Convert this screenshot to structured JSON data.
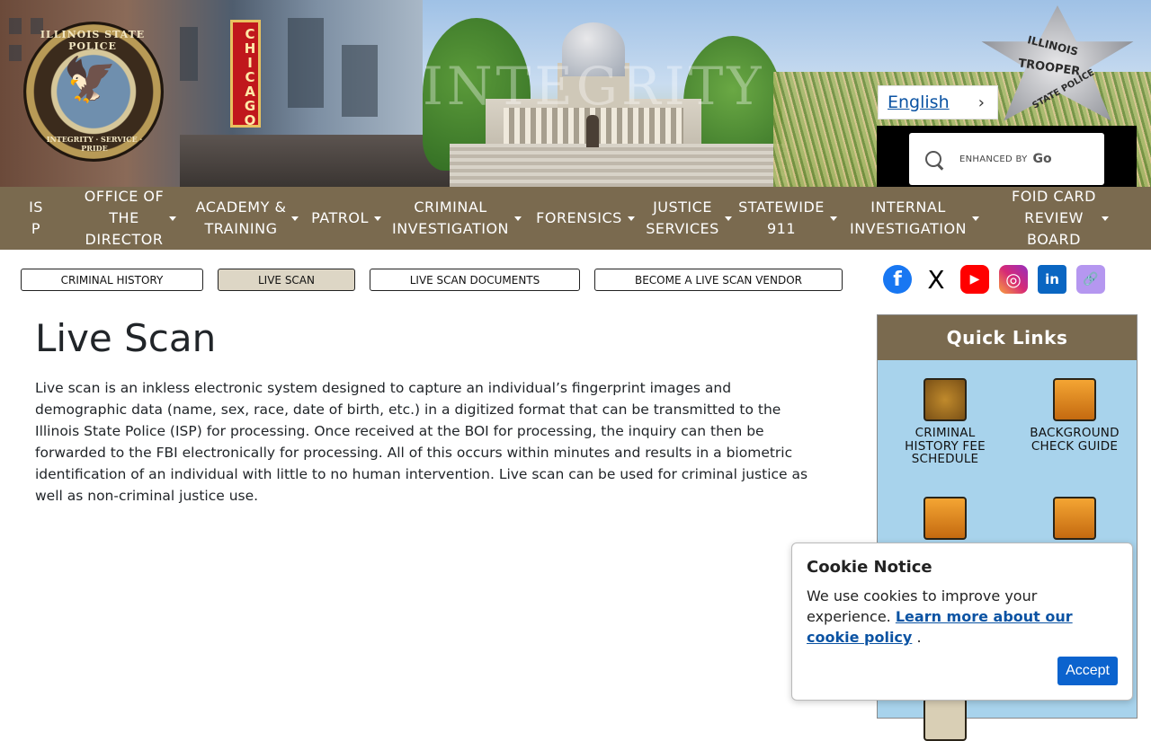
{
  "header": {
    "watermark": "INTEGRITY",
    "chicago_sign": "CHICAGO",
    "seal": {
      "top_text": "ILLINOIS STATE POLICE",
      "bottom_text": "INTEGRITY · SERVICE · PRIDE"
    },
    "badge": {
      "line1": "ILLINOIS",
      "line2": "TROOPER",
      "line3": "STATE POLICE"
    },
    "language": {
      "label": "English",
      "chevron": "›"
    },
    "search": {
      "enhanced_by": "ENHANCED BY",
      "go": "Go"
    }
  },
  "nav": {
    "items": [
      {
        "label": "IS\nP",
        "has_menu": false
      },
      {
        "label": "OFFICE OF\nTHE\nDIRECTOR",
        "has_menu": true
      },
      {
        "label": "ACADEMY &\nTRAINING",
        "has_menu": true
      },
      {
        "label": "PATROL",
        "has_menu": true
      },
      {
        "label": "CRIMINAL\nINVESTIGATION",
        "has_menu": true
      },
      {
        "label": "FORENSICS",
        "has_menu": true
      },
      {
        "label": "JUSTICE\nSERVICES",
        "has_menu": true
      },
      {
        "label": "STATEWIDE\n911",
        "has_menu": true
      },
      {
        "label": "INTERNAL\nINVESTIGATION",
        "has_menu": true
      },
      {
        "label": "FOID CARD\nREVIEW\nBOARD",
        "has_menu": true
      }
    ]
  },
  "subnav": {
    "criminal_history": "CRIMINAL HISTORY",
    "live_scan": "LIVE SCAN",
    "live_scan_documents": "LIVE SCAN DOCUMENTS",
    "become_vendor": "BECOME A LIVE SCAN VENDOR"
  },
  "social": {
    "facebook": "f",
    "x": "X",
    "youtube": "▶",
    "instagram": "◎",
    "linkedin": "in",
    "link": "🔗"
  },
  "main": {
    "title": "Live Scan",
    "body": "Live scan is an inkless electronic system designed to capture an individual’s fingerprint images and demographic data (name, sex, race, date of birth, etc.) in a digitized format that can be transmitted to the Illinois State Police (ISP) for processing. Once received at the BOI for processing, the inquiry can then be forwarded to the FBI electronically for processing. All of this occurs within minutes and results in a biometric identification of an individual with little to no human intervention. Live scan can be used for criminal justice as well as non-criminal justice use."
  },
  "quick_links": {
    "title": "Quick Links",
    "items": [
      {
        "label": "CRIMINAL HISTORY FEE SCHEDULE",
        "icon": "fingerprint-icon"
      },
      {
        "label": "BACKGROUND CHECK GUIDE",
        "icon": "magnifier-check-icon"
      },
      {
        "label": "",
        "icon": "cannabis-leaf-icon"
      },
      {
        "label": "",
        "icon": "document-seal-icon"
      }
    ]
  },
  "cookie": {
    "title": "Cookie Notice",
    "text": "We use cookies to improve your experience.",
    "link": "Learn more about our cookie policy",
    "period": ".",
    "accept": "Accept"
  },
  "colors": {
    "nav_bg": "#7a6a4f",
    "accent_blue": "#0b63ce",
    "quick_links_bg": "#a8d3ec"
  }
}
